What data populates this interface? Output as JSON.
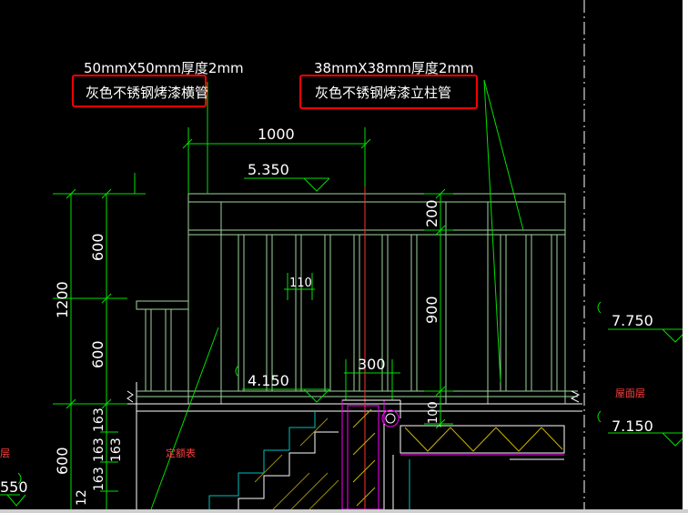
{
  "labels": {
    "spec_horizontal": "50mmX50mm厚度2mm",
    "spec_vertical": "38mmX38mm厚度2mm",
    "callout_horizontal": "灰色不锈钢烤漆横管",
    "callout_vertical": "灰色不锈钢烤漆立柱管",
    "roof_label": "屋面层",
    "stair_label": "定额表",
    "left_label": "层"
  },
  "dimensions": {
    "span_top": "1000",
    "post_gap": "110",
    "width_300": "300",
    "height_1200": "1200",
    "height_600_upper": "600",
    "height_600_lower": "600",
    "height_600_bottom": "600",
    "height_200": "200",
    "height_900": "900",
    "height_100": "100",
    "stair_163a": "163",
    "stair_163b": "163",
    "stair_163c": "163",
    "stair_163d": "163",
    "dim_12": "12"
  },
  "elevations": {
    "el_5350": "5.350",
    "el_4150": "4.150",
    "el_7750": "7.750",
    "el_7150": "7.150",
    "el_left": "550"
  },
  "colors": {
    "background": "#000000",
    "line_white": "#ffffff",
    "dimension_green": "#00ff00",
    "structure_green": "#7fbf7f",
    "axis_red": "#ff3030",
    "highlight_red": "#ff0000",
    "pipe_magenta": "#ff00ff",
    "hatch_yellow": "#c8b400",
    "label_red": "#ff4040"
  }
}
